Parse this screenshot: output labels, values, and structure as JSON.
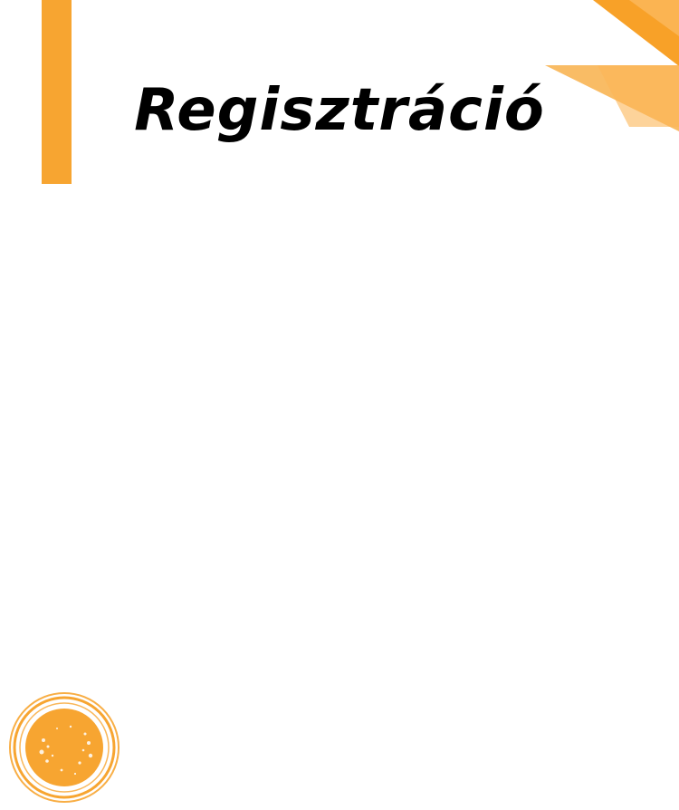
{
  "page": {
    "title": "Regisztráció"
  },
  "colors": {
    "accent": "#f7a531",
    "accent_dark": "#f89c1c",
    "accent_light": "#fbb657",
    "background": "#ffffff",
    "title_text": "#000000"
  },
  "icons": {
    "corner": "triangle-decoration-icon",
    "badge": "round-stamp-badge-icon"
  }
}
